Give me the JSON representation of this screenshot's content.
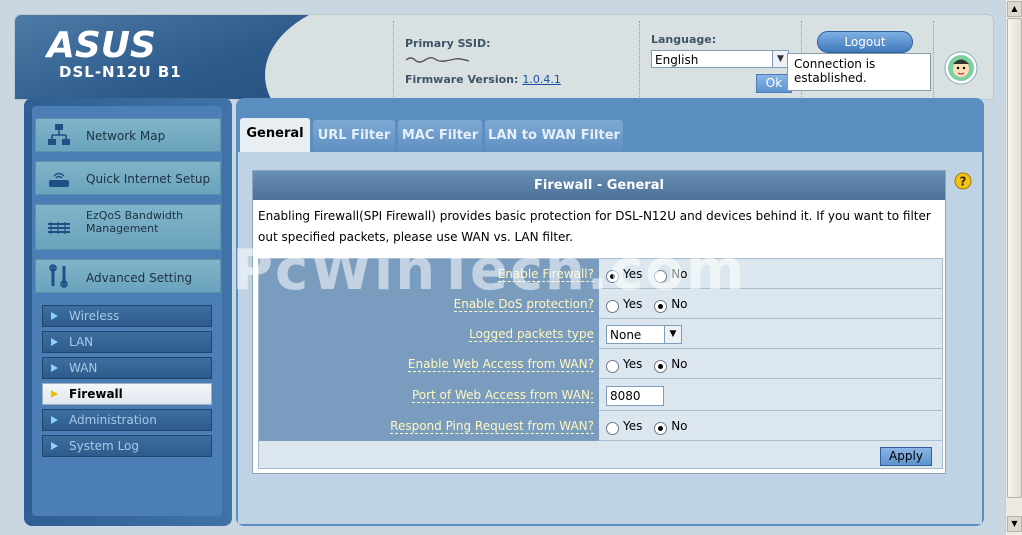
{
  "header": {
    "brand": "ASUS",
    "model": "DSL-N12U B1",
    "ssid_label": "Primary SSID:",
    "firmware_label": "Firmware Version:",
    "firmware_version": "1.0.4.1",
    "language_label": "Language:",
    "language_value": "English",
    "ok_label": "Ok",
    "logout_label": "Logout",
    "connection_status": "Connection is established."
  },
  "sidebar": {
    "main_items": [
      {
        "label": "Network Map",
        "icon": "network-map-icon"
      },
      {
        "label": "Quick Internet Setup",
        "icon": "router-icon"
      },
      {
        "label": "EzQoS Bandwidth Management",
        "icon": "bandwidth-icon"
      },
      {
        "label": "Advanced Setting",
        "icon": "tools-icon"
      }
    ],
    "sub_items": [
      {
        "label": "Wireless",
        "active": false
      },
      {
        "label": "LAN",
        "active": false
      },
      {
        "label": "WAN",
        "active": false
      },
      {
        "label": "Firewall",
        "active": true
      },
      {
        "label": "Administration",
        "active": false
      },
      {
        "label": "System Log",
        "active": false
      }
    ]
  },
  "tabs": [
    {
      "label": "General",
      "active": true
    },
    {
      "label": "URL Filter",
      "active": false
    },
    {
      "label": "MAC Filter",
      "active": false
    },
    {
      "label": "LAN to WAN Filter",
      "active": false
    }
  ],
  "firewall": {
    "title": "Firewall - General",
    "description": "Enabling Firewall(SPI Firewall) provides basic protection for DSL-N12U and devices behind it. If you want to filter out specified packets, please use WAN vs. LAN filter.",
    "yes_label": "Yes",
    "no_label": "No",
    "rows": [
      {
        "label": "Enable Firewall?",
        "type": "radio",
        "value": "Yes"
      },
      {
        "label": "Enable DoS protection?",
        "type": "radio",
        "value": "No"
      },
      {
        "label": "Logged packets type",
        "type": "select",
        "value": "None"
      },
      {
        "label": "Enable Web Access from WAN?",
        "type": "radio",
        "value": "No"
      },
      {
        "label": "Port of Web Access from WAN:",
        "type": "input",
        "value": "8080"
      },
      {
        "label": "Respond Ping Request from WAN?",
        "type": "radio",
        "value": "No"
      }
    ],
    "apply_label": "Apply"
  },
  "watermark": "PcWinTech.com",
  "colors": {
    "header_blue": "#2d5a8a",
    "main_panel": "#5b8ec0",
    "label_cell": "#7a9cbe",
    "label_text": "#fff8c0"
  }
}
